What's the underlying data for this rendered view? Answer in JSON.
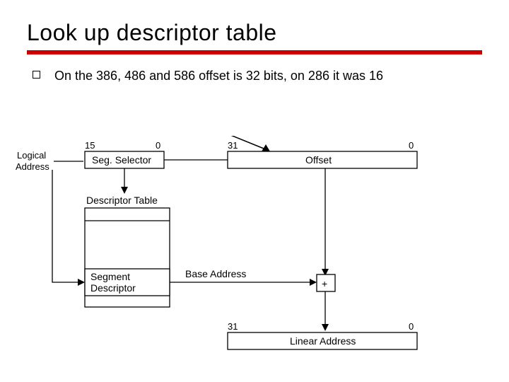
{
  "slide": {
    "title": "Look up descriptor table",
    "bullet": "On the 386, 486 and 586 offset is 32 bits, on 286 it was 16"
  },
  "diagram": {
    "labels": {
      "logical_address_l1": "Logical",
      "logical_address_l2": "Address",
      "seg_selector": "Seg. Selector",
      "seg_tick_left": "15",
      "seg_tick_right": "0",
      "offset": "Offset",
      "offset_tick_left": "31",
      "offset_tick_right": "0",
      "descriptor_table": "Descriptor Table",
      "segment_descriptor_l1": "Segment",
      "segment_descriptor_l2": "Descriptor",
      "base_address": "Base Address",
      "adder": "+",
      "linear_address": "Linear Address",
      "lin_tick_left": "31",
      "lin_tick_right": "0"
    }
  }
}
